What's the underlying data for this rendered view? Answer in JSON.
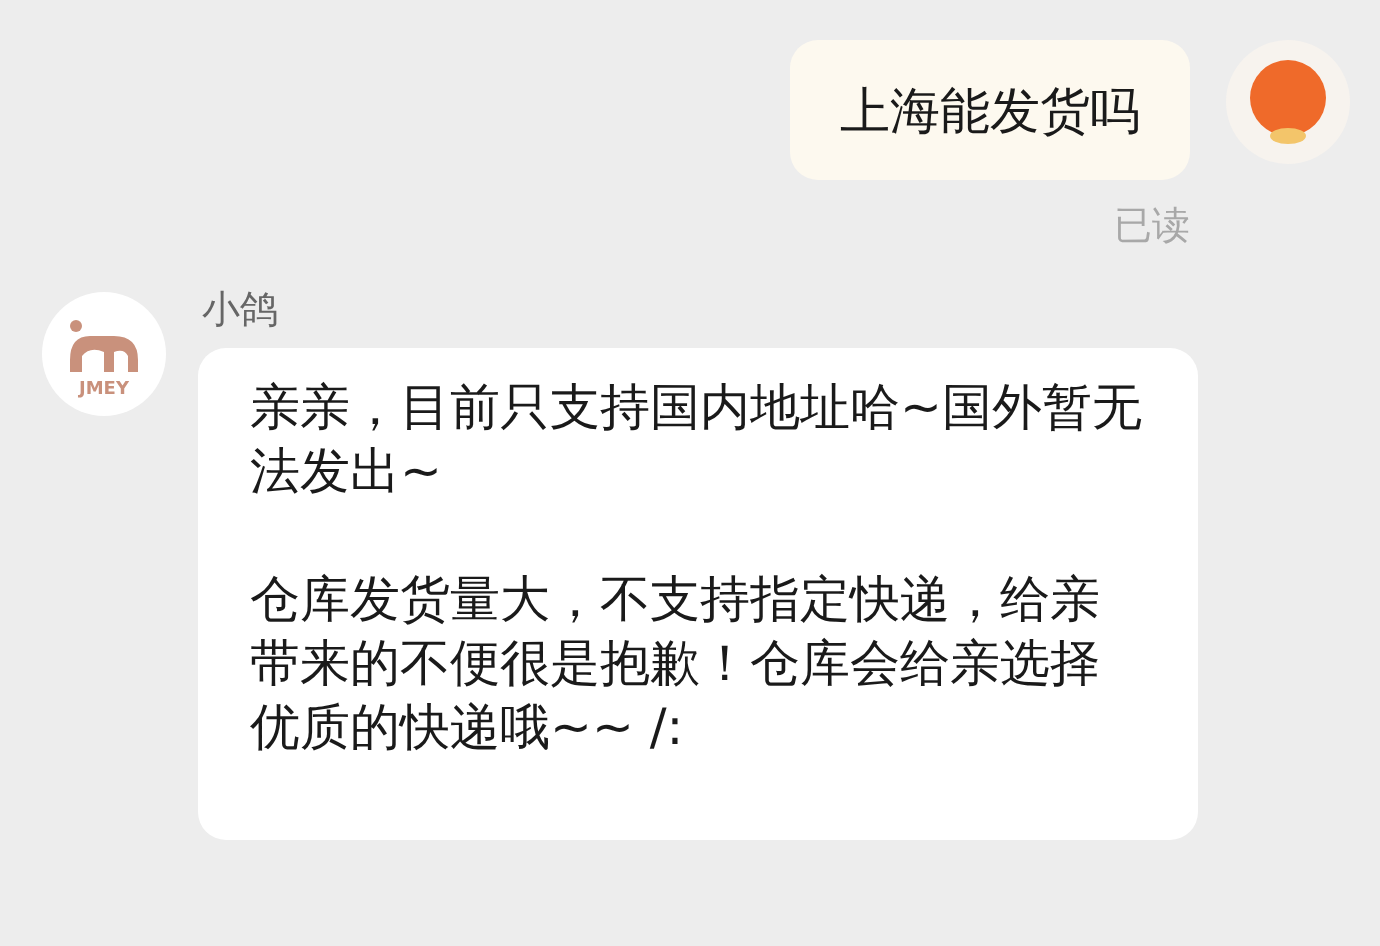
{
  "messages": [
    {
      "kind": "outgoing",
      "text": "上海能发货吗",
      "status": "已读"
    },
    {
      "kind": "incoming",
      "sender": "小鸽",
      "avatar_label": "JMEY",
      "paragraphs": [
        "亲亲，目前只支持国内地址哈~国外暂无法发出~",
        "仓库发货量大，不支持指定快递，给亲带来的不便很是抱歉！仓库会给亲选择优质的快递哦~~ /:"
      ]
    }
  ]
}
